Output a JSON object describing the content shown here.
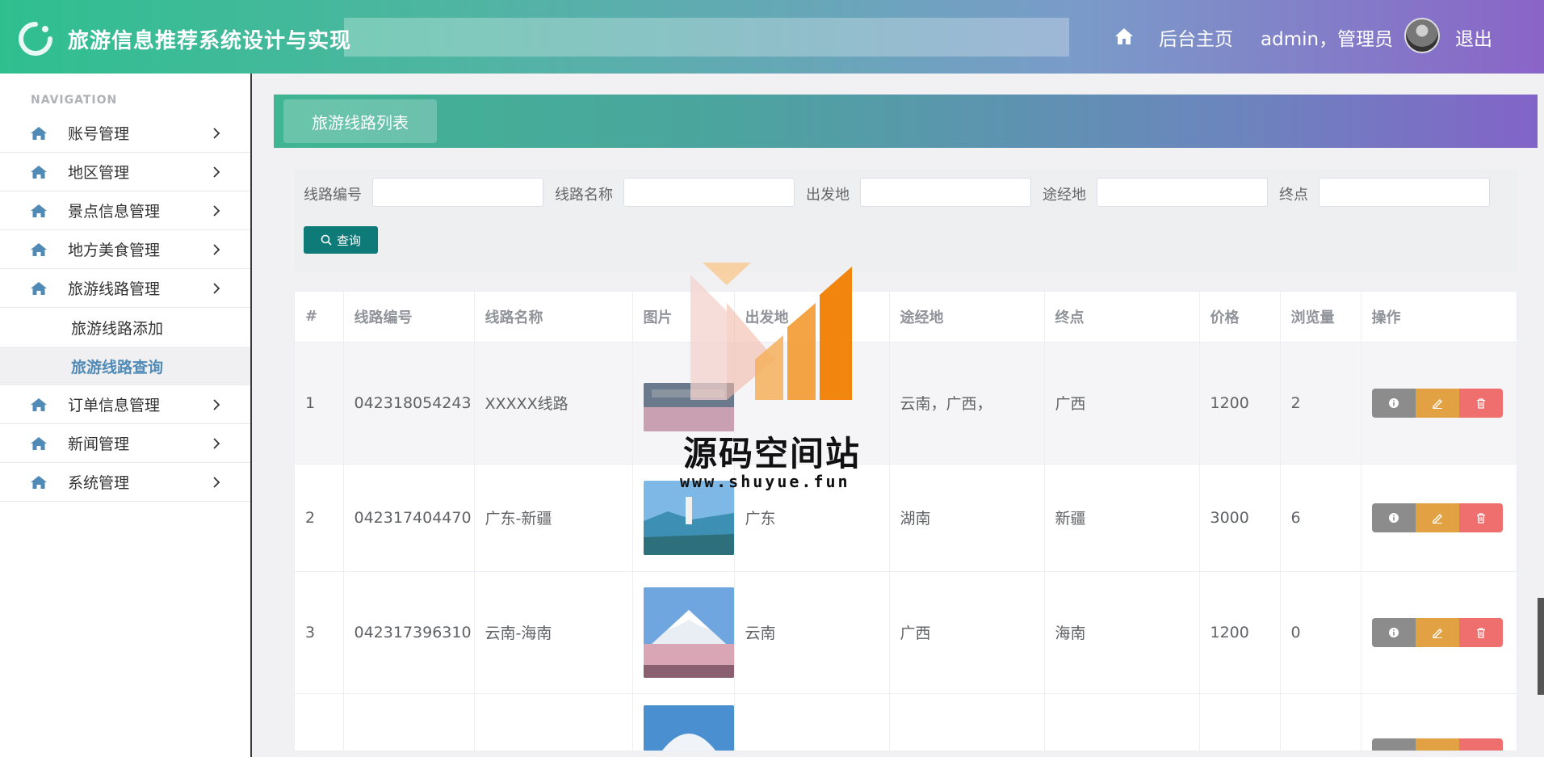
{
  "header": {
    "title": "旅游信息推荐系统设计与实现",
    "home_label": "后台主页",
    "user_label": "admin，管理员",
    "logout_label": "退出"
  },
  "sidebar": {
    "nav_title": "NAVIGATION",
    "items": [
      {
        "label": "账号管理"
      },
      {
        "label": "地区管理"
      },
      {
        "label": "景点信息管理"
      },
      {
        "label": "地方美食管理"
      },
      {
        "label": "旅游线路管理"
      },
      {
        "label": "旅游线路添加"
      },
      {
        "label": "旅游线路查询"
      },
      {
        "label": "订单信息管理"
      },
      {
        "label": "新闻管理"
      },
      {
        "label": "系统管理"
      }
    ]
  },
  "panel": {
    "tab_label": "旅游线路列表"
  },
  "search": {
    "fields": [
      {
        "label": "线路编号",
        "value": ""
      },
      {
        "label": "线路名称",
        "value": ""
      },
      {
        "label": "出发地",
        "value": ""
      },
      {
        "label": "途经地",
        "value": ""
      },
      {
        "label": "终点",
        "value": ""
      }
    ],
    "button_label": "查询"
  },
  "table": {
    "headers": [
      "#",
      "线路编号",
      "线路名称",
      "图片",
      "出发地",
      "途经地",
      "终点",
      "价格",
      "浏览量",
      "操作"
    ],
    "rows": [
      {
        "index": "1",
        "code": "042318054243",
        "name": "XXXXX线路",
        "from": "",
        "via": "云南，广西，",
        "to": "广西",
        "price": "1200",
        "views": "2"
      },
      {
        "index": "2",
        "code": "042317404470",
        "name": "广东-新疆",
        "from": "广东",
        "via": "湖南",
        "to": "新疆",
        "price": "3000",
        "views": "6"
      },
      {
        "index": "3",
        "code": "042317396310",
        "name": "云南-海南",
        "from": "云南",
        "via": "广西",
        "to": "海南",
        "price": "1200",
        "views": "0"
      }
    ]
  },
  "watermark": {
    "name": "源码空间站",
    "url": "www.shuyue.fun"
  },
  "colors": {
    "header_start": "#2fbf8f",
    "header_end": "#8a64c7",
    "search_button": "#0e7b79",
    "info_button": "#8c8c8c",
    "edit_button": "#e2a244",
    "delete_button": "#ef6f6f",
    "active_menu": "#4f8bb6"
  }
}
